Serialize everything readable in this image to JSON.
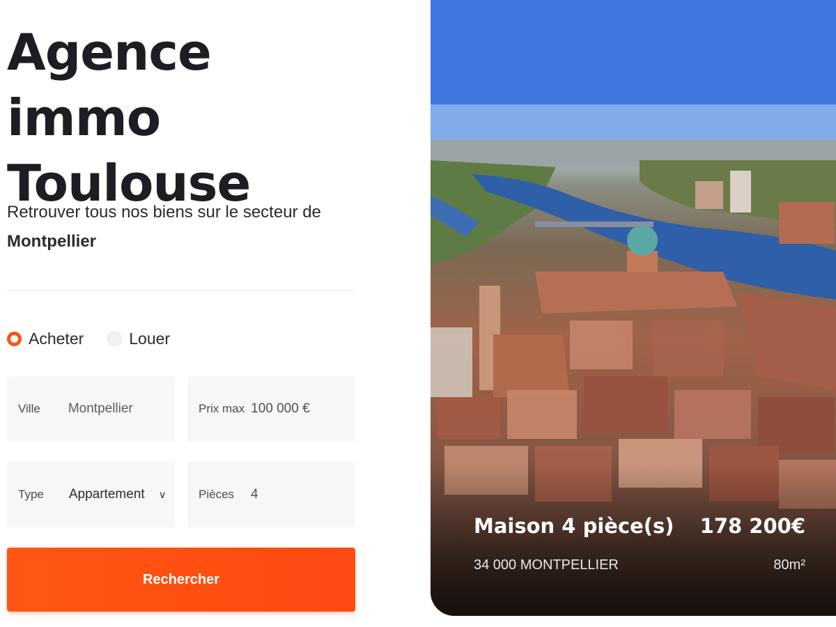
{
  "header": {
    "title_line1": "Agence immo",
    "title_line2": "Toulouse"
  },
  "intro": {
    "text": "Retrouver tous nos biens sur le secteur de",
    "city": "Montpellier"
  },
  "search": {
    "mode_options": [
      {
        "label": "Acheter",
        "selected": true
      },
      {
        "label": "Louer",
        "selected": false
      }
    ],
    "fields": {
      "ville": {
        "label": "Ville",
        "value": "Montpellier"
      },
      "prix_max": {
        "label": "Prix max",
        "value": "100 000 €"
      },
      "type": {
        "label": "Type",
        "value": "Appartement",
        "icon": "chevron-down-icon"
      },
      "pieces": {
        "label": "Pièces",
        "value": "4"
      }
    },
    "button_label": "Rechercher"
  },
  "featured_listing": {
    "title": "Maison 4 pièce(s)",
    "price": "178 200€",
    "location": "34 000 MONTPELLIER",
    "area": "80m²"
  },
  "colors": {
    "accent": "#ff5413",
    "text": "#1d1d24",
    "field_background": "#f7f7f7"
  }
}
